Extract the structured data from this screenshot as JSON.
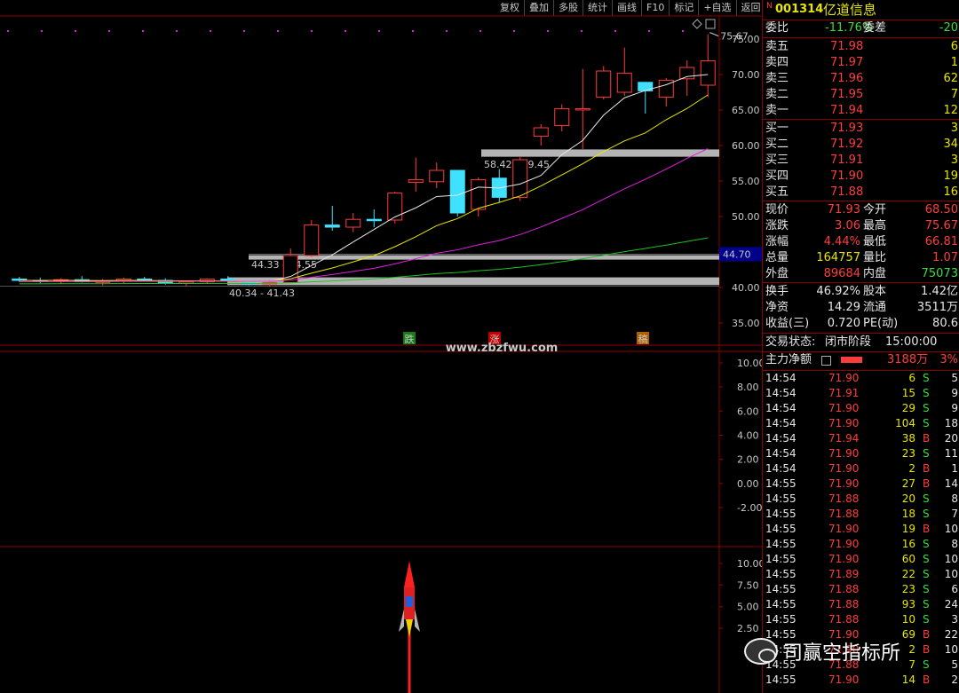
{
  "toolbar": {
    "items": [
      "复权",
      "叠加",
      "多股",
      "统计",
      "画线",
      "F10",
      "标记",
      "+自选",
      "返回"
    ]
  },
  "chart": {
    "price_axis": [
      "75.00",
      "70.00",
      "65.00",
      "60.00",
      "55.00",
      "50.00",
      "45.00",
      "40.00",
      "35.00"
    ],
    "current_price_tag": "44.70",
    "high_label": "75.67",
    "zone_labels": [
      "58.42 - 59.45",
      "44.33 - 44.55",
      "40.34 - 41.43"
    ],
    "signals": [
      "跌",
      "涨",
      "稿"
    ],
    "watermark_url": "www.zbzfwu.com",
    "osc1_axis": [
      "10.00",
      "8.00",
      "6.00",
      "4.00",
      "2.00",
      "0.00",
      "-2.00"
    ],
    "osc2_axis": [
      "10.00",
      "7.50",
      "5.00",
      "2.50"
    ],
    "colors": {
      "up": "#ff3c3c",
      "down": "#40e0ff",
      "ma5": "#e6e6e6",
      "ma10": "#e6e600",
      "ma20": "#e020e0",
      "ma60": "#20c020"
    }
  },
  "chart_data": {
    "type": "candlestick",
    "ohlc": [
      [
        41.2,
        41.5,
        40.8,
        41.0
      ],
      [
        41.0,
        41.4,
        40.6,
        40.9
      ],
      [
        40.9,
        41.3,
        40.5,
        41.1
      ],
      [
        41.1,
        41.6,
        40.7,
        40.8
      ],
      [
        40.8,
        41.2,
        40.3,
        40.9
      ],
      [
        40.9,
        41.4,
        40.6,
        41.2
      ],
      [
        41.2,
        41.5,
        40.9,
        41.0
      ],
      [
        41.0,
        41.3,
        40.4,
        40.6
      ],
      [
        40.6,
        41.0,
        40.2,
        40.8
      ],
      [
        40.8,
        41.3,
        40.5,
        41.2
      ],
      [
        41.2,
        41.6,
        40.8,
        40.9
      ],
      [
        40.9,
        41.2,
        40.3,
        40.5
      ],
      [
        40.5,
        41.0,
        40.2,
        40.7
      ],
      [
        40.7,
        45.5,
        40.6,
        44.5
      ],
      [
        44.5,
        49.5,
        44.3,
        48.8
      ],
      [
        48.8,
        51.5,
        48.0,
        48.5
      ],
      [
        48.5,
        50.5,
        47.8,
        49.6
      ],
      [
        49.6,
        51.0,
        48.5,
        49.5
      ],
      [
        49.5,
        53.5,
        49.0,
        53.3
      ],
      [
        54.8,
        58.3,
        53.5,
        55.2
      ],
      [
        54.9,
        57.6,
        54.0,
        56.5
      ],
      [
        56.5,
        55.0,
        50.0,
        50.5
      ],
      [
        51.0,
        55.5,
        50.0,
        55.2
      ],
      [
        55.4,
        56.7,
        52.0,
        52.7
      ],
      [
        52.7,
        58.5,
        52.2,
        58.0
      ],
      [
        61.3,
        63.0,
        60.0,
        62.5
      ],
      [
        62.8,
        65.8,
        62.0,
        65.2
      ],
      [
        65.2,
        70.8,
        59.5,
        65.2
      ],
      [
        66.8,
        71.2,
        66.5,
        70.5
      ],
      [
        67.5,
        73.8,
        67.0,
        70.2
      ],
      [
        68.9,
        68.9,
        64.5,
        67.7
      ],
      [
        66.8,
        69.5,
        65.5,
        69.2
      ],
      [
        69.4,
        72.0,
        67.0,
        71.0
      ],
      [
        68.5,
        75.67,
        66.8,
        71.93
      ]
    ]
  },
  "quote": {
    "code": "001314",
    "name": "亿道信息",
    "badge": "N",
    "weibi_label": "委比",
    "weibi_value": "-11.76%",
    "weicha_label": "委差",
    "weicha_value": "-20",
    "asks": [
      {
        "label": "卖五",
        "price": "71.98",
        "vol": "6"
      },
      {
        "label": "卖四",
        "price": "71.97",
        "vol": "1"
      },
      {
        "label": "卖三",
        "price": "71.96",
        "vol": "62"
      },
      {
        "label": "卖二",
        "price": "71.95",
        "vol": "7"
      },
      {
        "label": "卖一",
        "price": "71.94",
        "vol": "12"
      }
    ],
    "bids": [
      {
        "label": "买一",
        "price": "71.93",
        "vol": "3"
      },
      {
        "label": "买二",
        "price": "71.92",
        "vol": "34"
      },
      {
        "label": "买三",
        "price": "71.91",
        "vol": "3"
      },
      {
        "label": "买四",
        "price": "71.90",
        "vol": "19"
      },
      {
        "label": "买五",
        "price": "71.88",
        "vol": "16"
      }
    ],
    "stats": [
      {
        "l1": "现价",
        "v1": "71.93",
        "l2": "今开",
        "v2": "68.50"
      },
      {
        "l1": "涨跌",
        "v1": "3.06",
        "l2": "最高",
        "v2": "75.67"
      },
      {
        "l1": "涨幅",
        "v1": "4.44%",
        "l2": "最低",
        "v2": "66.81"
      },
      {
        "l1": "总量",
        "v1": "164757",
        "l2": "量比",
        "v2": "1.07"
      },
      {
        "l1": "外盘",
        "v1": "89684",
        "l2": "内盘",
        "v2": "75073"
      }
    ],
    "stats2": [
      {
        "l1": "换手",
        "v1": "46.92%",
        "l2": "股本",
        "v2": "1.42亿"
      },
      {
        "l1": "净资",
        "v1": "14.29",
        "l2": "流通",
        "v2": "3511万"
      },
      {
        "l1": "收益(三)",
        "v1": "0.720",
        "l2": "PE(动)",
        "v2": "80.6"
      }
    ],
    "trade_status_label": "交易状态:",
    "trade_status": "闭市阶段",
    "trade_time": "15:00:00",
    "main_force_label": "主力净额",
    "main_force_value": "3188万",
    "main_force_pct": "3%"
  },
  "ticks": [
    {
      "t": "14:54",
      "p": "71.90",
      "v": "6",
      "s": "S",
      "n": "5"
    },
    {
      "t": "14:54",
      "p": "71.91",
      "v": "15",
      "s": "S",
      "n": "9"
    },
    {
      "t": "14:54",
      "p": "71.90",
      "v": "29",
      "s": "S",
      "n": "9"
    },
    {
      "t": "14:54",
      "p": "71.90",
      "v": "104",
      "s": "S",
      "n": "18"
    },
    {
      "t": "14:54",
      "p": "71.94",
      "v": "38",
      "s": "B",
      "n": "20"
    },
    {
      "t": "14:54",
      "p": "71.90",
      "v": "23",
      "s": "S",
      "n": "11"
    },
    {
      "t": "14:54",
      "p": "71.90",
      "v": "2",
      "s": "B",
      "n": "1"
    },
    {
      "t": "14:55",
      "p": "71.90",
      "v": "27",
      "s": "B",
      "n": "14"
    },
    {
      "t": "14:55",
      "p": "71.88",
      "v": "20",
      "s": "S",
      "n": "8"
    },
    {
      "t": "14:55",
      "p": "71.88",
      "v": "18",
      "s": "S",
      "n": "7"
    },
    {
      "t": "14:55",
      "p": "71.90",
      "v": "19",
      "s": "B",
      "n": "10"
    },
    {
      "t": "14:55",
      "p": "71.90",
      "v": "16",
      "s": "S",
      "n": "8"
    },
    {
      "t": "14:55",
      "p": "71.90",
      "v": "60",
      "s": "S",
      "n": "10"
    },
    {
      "t": "14:55",
      "p": "71.89",
      "v": "22",
      "s": "S",
      "n": "10"
    },
    {
      "t": "14:55",
      "p": "71.88",
      "v": "23",
      "s": "S",
      "n": "6"
    },
    {
      "t": "14:55",
      "p": "71.88",
      "v": "93",
      "s": "S",
      "n": "24"
    },
    {
      "t": "14:55",
      "p": "71.88",
      "v": "10",
      "s": "S",
      "n": "3"
    },
    {
      "t": "14:55",
      "p": "71.90",
      "v": "69",
      "s": "B",
      "n": "22"
    },
    {
      "t": "14:55",
      "p": "71.90",
      "v": "2",
      "s": "B",
      "n": "10"
    },
    {
      "t": "14:55",
      "p": "71.88",
      "v": "7",
      "s": "S",
      "n": "5"
    },
    {
      "t": "14:55",
      "p": "71.90",
      "v": "14",
      "s": "B",
      "n": "2"
    }
  ],
  "watermark_text": "司赢空指标所"
}
